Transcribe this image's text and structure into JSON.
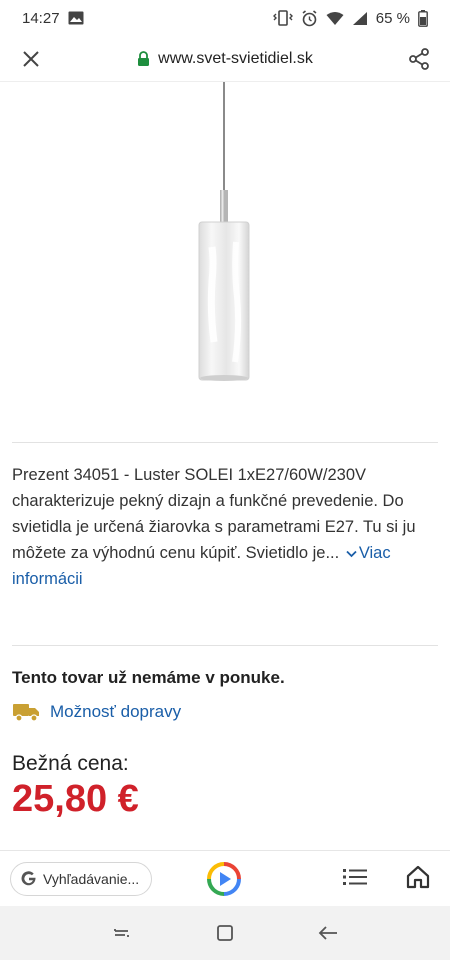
{
  "status": {
    "time": "14:27",
    "battery": "65 %"
  },
  "browser": {
    "url": "www.svet-svietidiel.sk"
  },
  "product": {
    "description": "Prezent 34051 - Luster SOLEI 1xE27/60W/230V charakterizuje pekný dizajn a funkčné prevedenie. Do svietidla je určená žiarovka s parametrami E27. Tu si ju môžete za výhodnú cenu kúpiť. Svietidlo je...",
    "more_link": "Viac informácii",
    "stock_notice": "Tento tovar už nemáme v ponuke.",
    "delivery_link": "Možnosť dopravy",
    "price_label": "Bežná cena:",
    "price": "25,80 €"
  },
  "toolbar": {
    "search_placeholder": "Vyhľadávanie..."
  },
  "colors": {
    "price": "#d0212a",
    "link": "#1a5ea8",
    "truck": "#c9a033",
    "lock": "#1e8e3e"
  }
}
